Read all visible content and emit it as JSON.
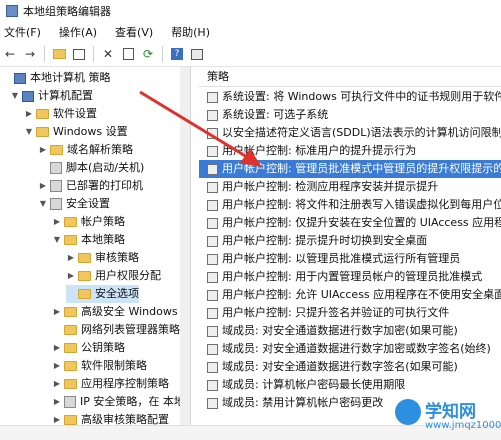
{
  "window": {
    "title": "本地组策略编辑器"
  },
  "menubar": {
    "items": [
      "文件(F)",
      "操作(A)",
      "查看(V)",
      "帮助(H)"
    ]
  },
  "toolbar": {
    "icons": [
      "back-arrow-icon",
      "forward-arrow-icon",
      "folder-up-icon",
      "show-hide-tree-icon",
      "delete-icon",
      "properties-icon",
      "refresh-icon",
      "help-icon",
      "filter-icon"
    ]
  },
  "tree": {
    "items": [
      "本地计算机 策略",
      "计算机配置",
      "软件设置",
      "Windows 设置",
      "域名解析策略",
      "脚本(启动/关机)",
      "已部署的打印机",
      "安全设置",
      "帐户策略",
      "本地策略",
      "审核策略",
      "用户权限分配",
      "安全选项",
      "高级安全 Windows 防火",
      "网络列表管理器策略",
      "公钥策略",
      "软件限制策略",
      "应用程序控制策略",
      "IP 安全策略，在 本地计",
      "高级审核策略配置"
    ]
  },
  "list": {
    "header": "策略",
    "rows": [
      "系统设置: 将 Windows 可执行文件中的证书规则用于软件...",
      "系统设置: 可选子系统",
      "以安全描述符定义语言(SDDL)语法表示的计算机访问限制",
      "用户帐户控制: 标准用户的提升提示行为",
      "用户帐户控制: 管理员批准模式中管理员的提升权限提示的...",
      "用户帐户控制: 检测应用程序安装并提示提升",
      "用户帐户控制: 将文件和注册表写入错误虚拟化到每用户位置",
      "用户帐户控制: 仅提升安装在安全位置的 UIAccess 应用程序",
      "用户帐户控制: 提示提升时切换到安全桌面",
      "用户帐户控制: 以管理员批准模式运行所有管理员",
      "用户帐户控制: 用于内置管理员帐户的管理员批准模式",
      "用户帐户控制: 允许 UIAccess 应用程序在不使用安全桌面...",
      "用户帐户控制: 只提升签名并验证的可执行文件",
      "域成员: 对安全通道数据进行数字加密(如果可能)",
      "域成员: 对安全通道数据进行数字加密或数字签名(始终)",
      "域成员: 对安全通道数据进行数字签名(如果可能)",
      "域成员: 计算机帐户密码最长使用期限",
      "域成员: 禁用计算机帐户密码更改"
    ]
  },
  "watermark": {
    "name": "学知网",
    "url": "www.jmqz1000.com"
  },
  "colors": {
    "selection": "#3a7bd5",
    "arrow": "#e0322a",
    "watermark": "#2d8fe0"
  }
}
